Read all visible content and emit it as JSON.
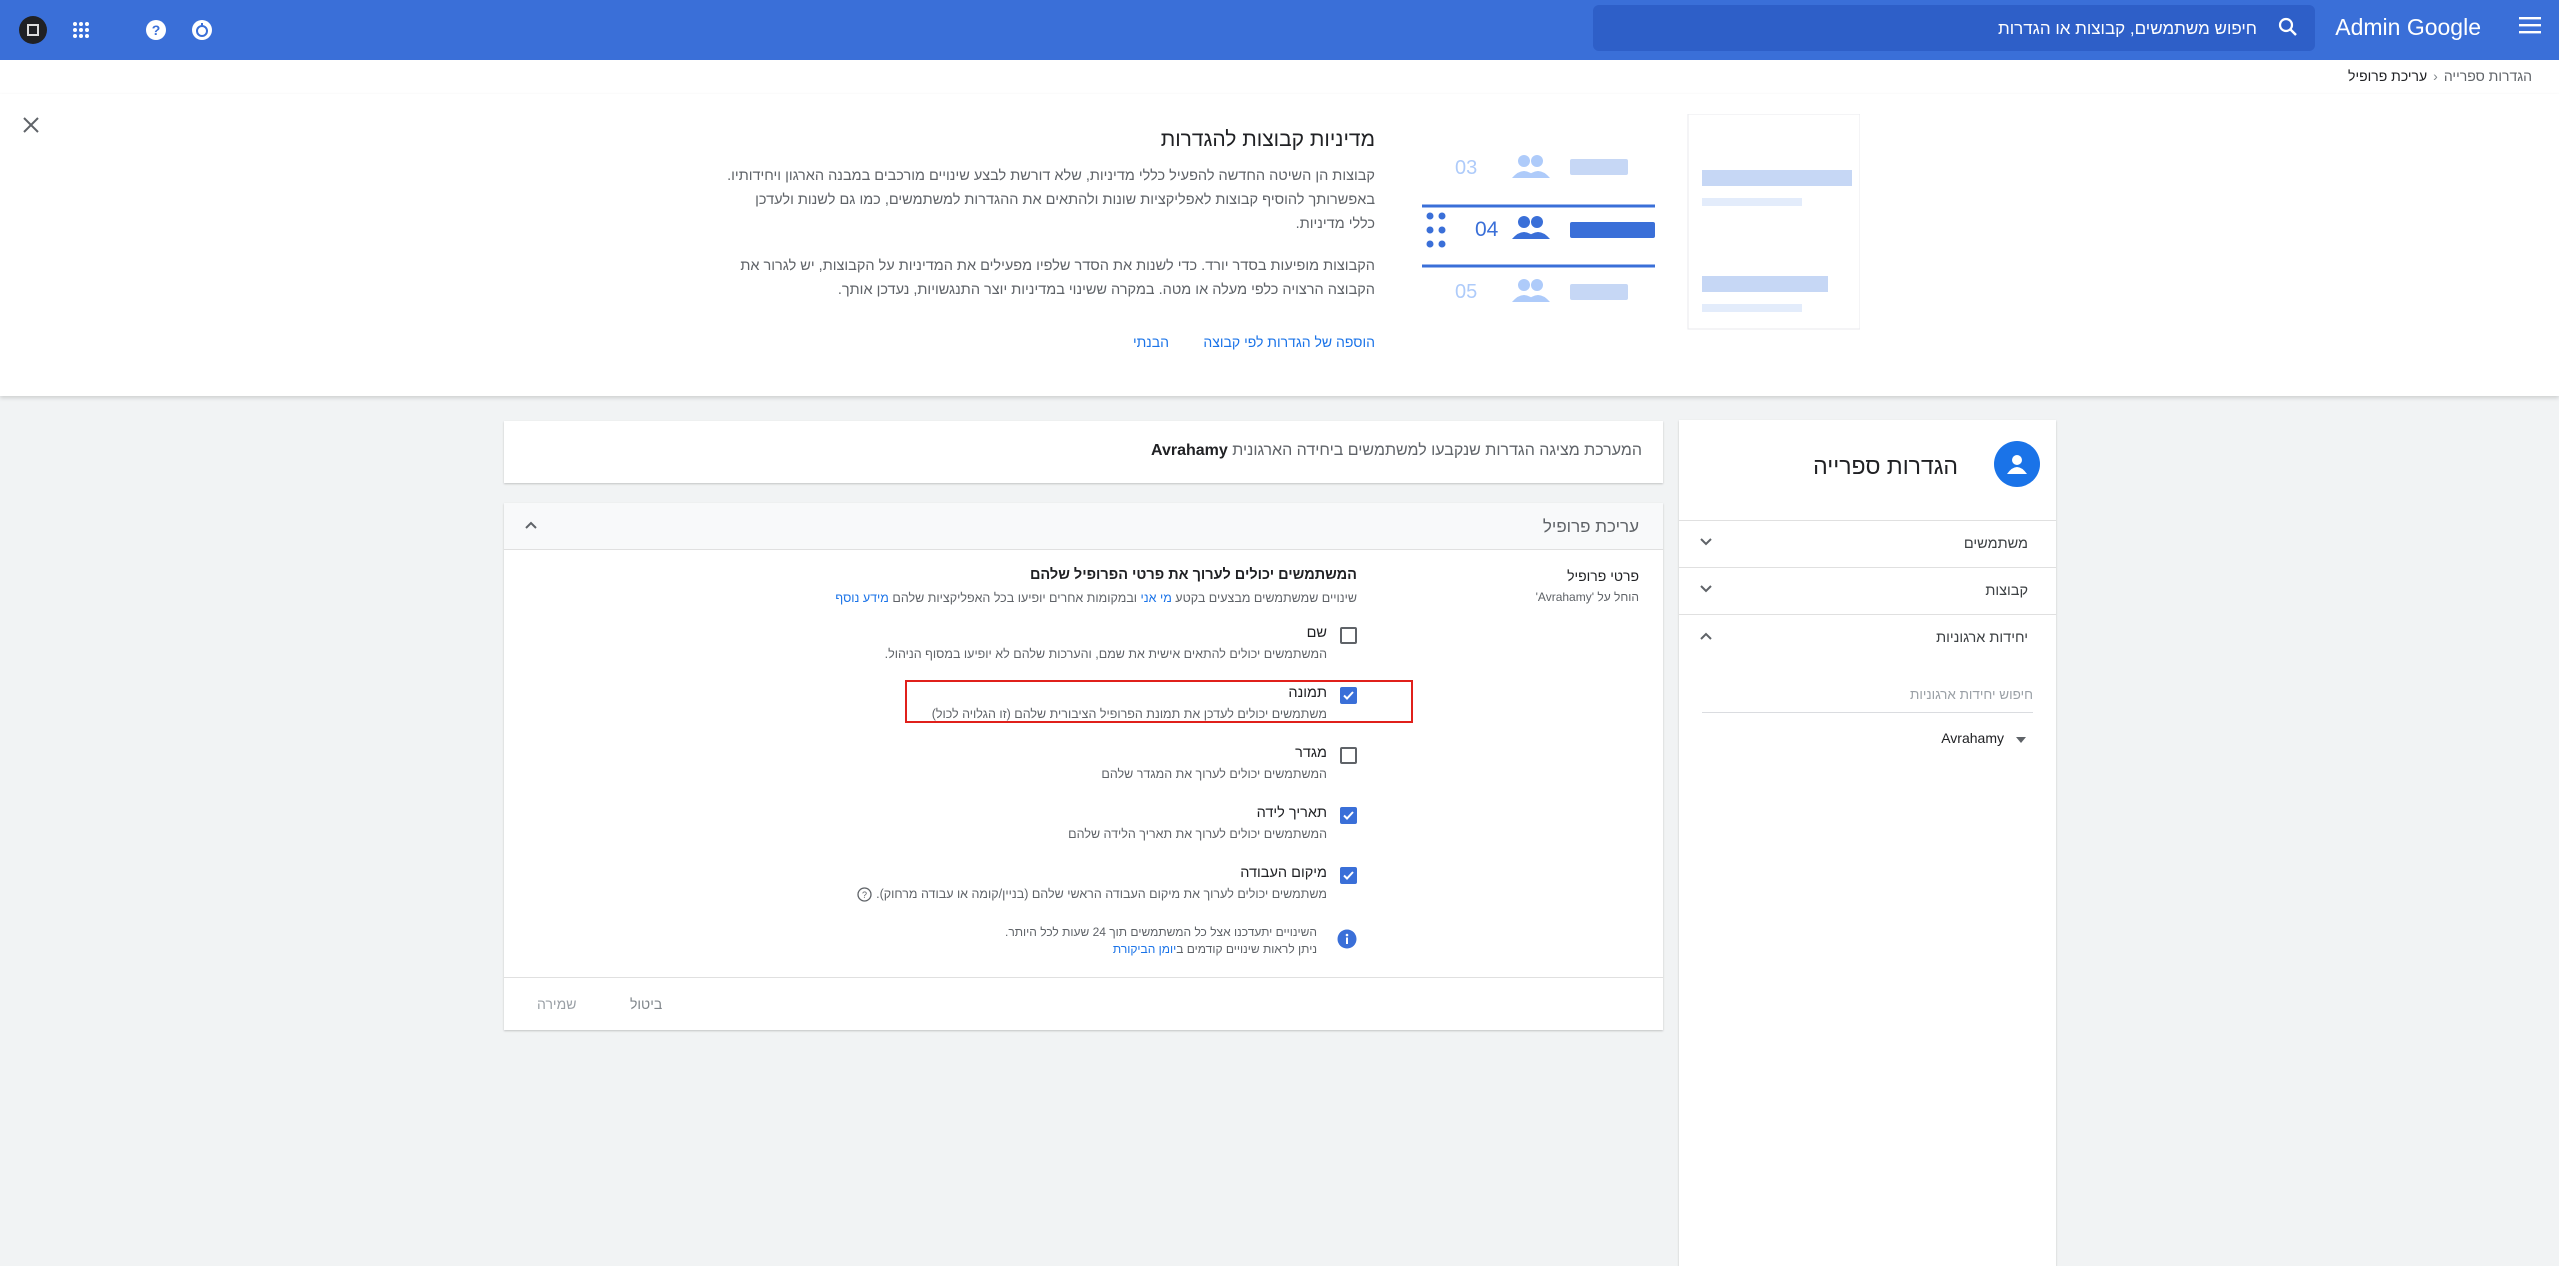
{
  "topbar": {
    "brand": "Admin Google",
    "search_placeholder": "חיפוש משתמשים, קבוצות או הגדרות"
  },
  "breadcrumb": {
    "parent": "הגדרות ספרייה",
    "current": "עריכת פרופיל"
  },
  "banner": {
    "title": "מדיניות קבוצות להגדרות",
    "paragraph1": "קבוצות הן השיטה החדשה להפעיל כללי מדיניות, שלא דורשת לבצע שינויים מורכבים במבנה הארגון ויחידותיו. באפשרותך להוסיף קבוצות לאפליקציות שונות ולהתאים את ההגדרות למשתמשים, כמו גם לשנות ולעדכן כללי מדיניות.",
    "paragraph2": "הקבוצות מופיעות בסדר יורד. כדי לשנות את הסדר שלפיו מפעילים את המדיניות על הקבוצות, יש לגרור את הקבוצה הרצויה כלפי מעלה או מטה. במקרה ששינוי במדיניות יוצר התנגשויות, נעדכן אותך.",
    "add_link": "הוספה של הגדרות לפי קבוצה",
    "got_it": "הבנתי",
    "illustration": {
      "n1": "03",
      "n2": "04",
      "n3": "05"
    }
  },
  "left_panel": {
    "title": "הגדרות ספרייה",
    "sections": [
      {
        "label": "משתמשים"
      },
      {
        "label": "קבוצות"
      },
      {
        "label": "יחידות ארגוניות"
      }
    ],
    "ou_search_placeholder": "חיפוש יחידות ארגוניות",
    "ou_item": "Avrahamy"
  },
  "info": {
    "text": "המערכת מציגה הגדרות שנקבעו למשתמשים ביחידה הארגונית",
    "org": "Avrahamy"
  },
  "main": {
    "title": "עריכת פרופיל",
    "side_label": "פרטי פרופיל",
    "side_sub": "הוחל על 'Avrahamy'",
    "section_title": "המשתמשים יכולים לערוך את פרטי הפרופיל שלהם",
    "section_desc_a": "שינויים שמשתמשים מבצעים בקטע",
    "section_desc_link1": "מי אני",
    "section_desc_b": "ובמקומות אחרים יופיעו בכל האפליקציות שלהם",
    "section_desc_link2": "מידע נוסף",
    "options": [
      {
        "label": "שם",
        "desc": "המשתמשים יכולים להתאים אישית את שמם, והערכות שלהם לא יופיעו במסוף הניהול.",
        "checked": false
      },
      {
        "label": "תמונה",
        "desc": "משתמשים יכולים לעדכן את תמונת הפרופיל הציבורית שלהם (זו הגלויה לכול)",
        "checked": true
      },
      {
        "label": "מגדר",
        "desc": "המשתמשים יכולים לערוך את המגדר שלהם",
        "checked": false
      },
      {
        "label": "תאריך לידה",
        "desc": "המשתמשים יכולים לערוך את תאריך הלידה שלהם",
        "checked": true
      },
      {
        "label": "מיקום העבודה",
        "desc": "משתמשים יכולים לערוך את מיקום העבודה הראשי שלהם (בניין/קומה או עבודה מרחוק).",
        "checked": true
      }
    ],
    "note_line1": "השינויים יתעדכנו אצל כל המשתמשים תוך 24 שעות לכל היותר.",
    "note_line2_a": "ניתן לראות שינויים קודמים ב",
    "note_line2_link": "יומן הביקורת",
    "cancel": "ביטול",
    "save": "שמירה"
  },
  "colors": {
    "topbar": "#3a6fd8",
    "accent": "#1a73e8",
    "highlight": "#e0201b"
  }
}
